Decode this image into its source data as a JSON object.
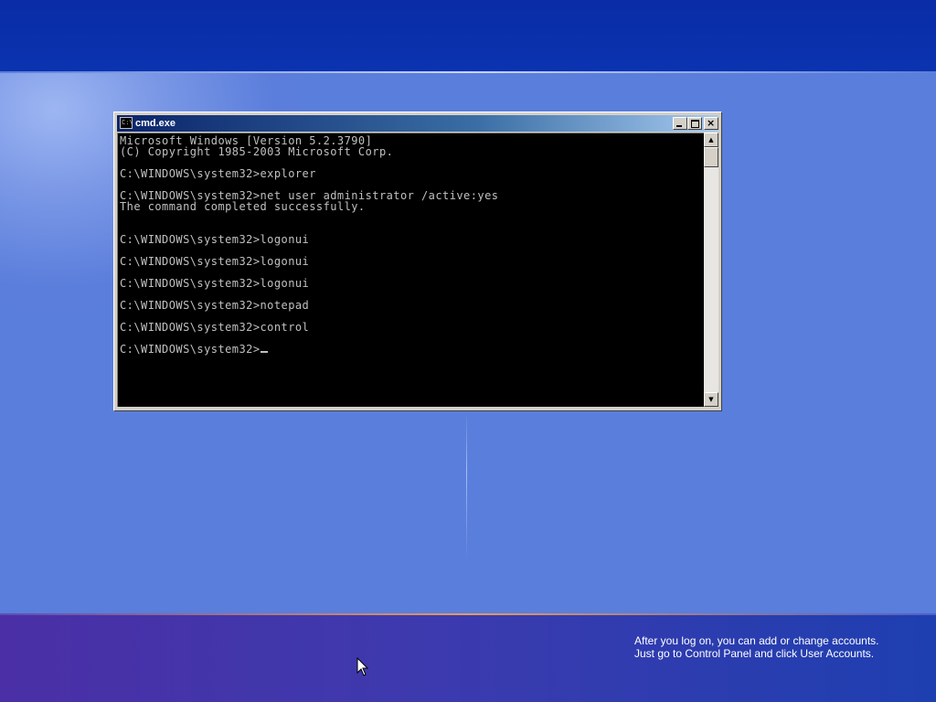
{
  "window": {
    "title": "cmd.exe",
    "icon": "cmd-icon",
    "icon_text": "C:\\",
    "controls": {
      "minimize": "minimize-icon",
      "maximize": "maximize-icon",
      "close": "close-icon"
    }
  },
  "console": {
    "lines": [
      "Microsoft Windows [Version 5.2.3790]",
      "(C) Copyright 1985-2003 Microsoft Corp.",
      "",
      "C:\\WINDOWS\\system32>explorer",
      "",
      "C:\\WINDOWS\\system32>net user administrator /active:yes",
      "The command completed successfully.",
      "",
      "",
      "C:\\WINDOWS\\system32>logonui",
      "",
      "C:\\WINDOWS\\system32>logonui",
      "",
      "C:\\WINDOWS\\system32>logonui",
      "",
      "C:\\WINDOWS\\system32>notepad",
      "",
      "C:\\WINDOWS\\system32>control",
      ""
    ],
    "prompt": "C:\\WINDOWS\\system32>",
    "text_color": "#c0c0c0",
    "background_color": "#000000"
  },
  "scrollbar": {
    "up_icon": "scroll-up-arrow-icon",
    "down_icon": "scroll-down-arrow-icon"
  },
  "hint": {
    "line1": "After you log on, you can add or change accounts.",
    "line2": "Just go to Control Panel and click User Accounts."
  },
  "colors": {
    "top_band": "#0b33b0",
    "main_area": "#5a7edc",
    "bottom_band": "#3d3aae",
    "title_bar": "#0a246a"
  }
}
